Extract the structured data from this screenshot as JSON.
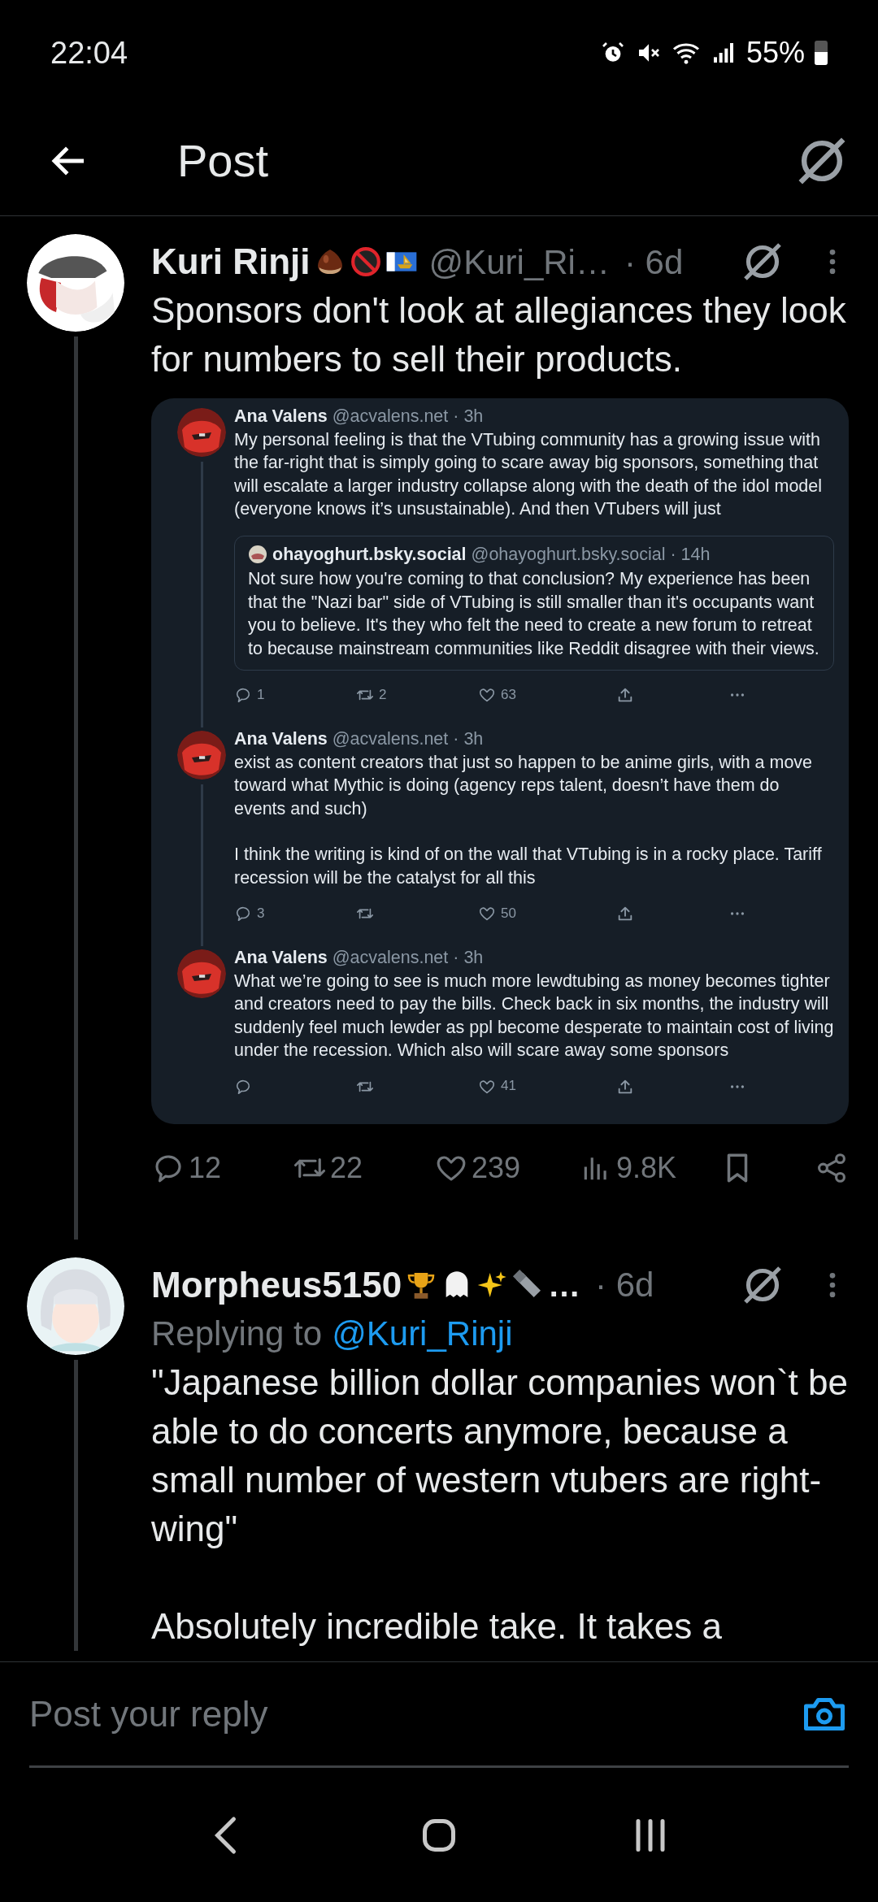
{
  "status_bar": {
    "time": "22:04",
    "battery": "55%"
  },
  "header": {
    "title": "Post"
  },
  "posts": [
    {
      "author": "Kuri Rinji",
      "badges": [
        {
          "kind": "chestnut"
        },
        {
          "kind": "no-under-18"
        },
        {
          "kind": "flag"
        }
      ],
      "handle": "@Kuri_Ri…",
      "time": "· 6d",
      "thread_line": true,
      "paragraphs": [
        "Sponsors don't look at allegiances they look for numbers to sell their products."
      ],
      "embedded_screenshot": {
        "posts": [
          {
            "author": "Ana Valens",
            "meta": "@acvalens.net · 3h",
            "thread_line": true,
            "paragraphs": [
              "My personal feeling is that the VTubing community has a growing issue with the far-right that is simply going to scare away big sponsors, something that will escalate a larger industry collapse along with the death of the idol model (everyone knows it’s unsustainable). And then VTubers will just"
            ],
            "quote": {
              "author": "ohayoghurt.bsky.social",
              "meta": "@ohayoghurt.bsky.social · 14h",
              "text": "Not sure how you're coming to that conclusion?  My experience has been that the \"Nazi bar\" side of VTubing is still smaller than it's occupants want you to believe.  It's they who felt the need to create a new forum to retreat to because mainstream communities like Reddit disagree with their views."
            },
            "replies": "1",
            "reposts": "2",
            "likes": "63"
          },
          {
            "author": "Ana Valens",
            "meta": "@acvalens.net · 3h",
            "thread_line": true,
            "paragraphs": [
              "exist as content creators that just so happen to be anime girls, with a move toward what Mythic is doing (agency reps talent, doesn’t have them do events and such)",
              "I think the writing is kind of on the wall that VTubing is in a rocky place. Tariff recession will be the catalyst for all this"
            ],
            "replies": "3",
            "likes": "50"
          },
          {
            "author": "Ana Valens",
            "meta": "@acvalens.net · 3h",
            "thread_line": false,
            "paragraphs": [
              "What we’re going to see is much more lewdtubing as money becomes tighter and creators need to pay the bills. Check back in six months, the industry will suddenly feel much lewder as ppl become desperate to maintain cost of living under the recession. Which also will scare away some sponsors"
            ],
            "likes": "41"
          }
        ]
      },
      "actions": {
        "replies": "12",
        "reposts": "22",
        "likes": "239",
        "views": "9.8K"
      }
    },
    {
      "author": "Morpheus5150",
      "badges": [
        {
          "kind": "trophy"
        },
        {
          "kind": "ghost"
        },
        {
          "kind": "sparkles"
        },
        {
          "kind": "bolt"
        }
      ],
      "author_more": "…",
      "time": "· 6d",
      "thread_line": true,
      "replying_label": "Replying to",
      "replying_to": "@Kuri_Rinji",
      "paragraphs": [
        "\"Japanese billion dollar companies won`t be able to do concerts anymore, because a small number of western vtubers are right-wing\"",
        "Absolutely incredible take. It takes a"
      ]
    }
  ],
  "reply_bar": {
    "placeholder": "Post your reply"
  }
}
